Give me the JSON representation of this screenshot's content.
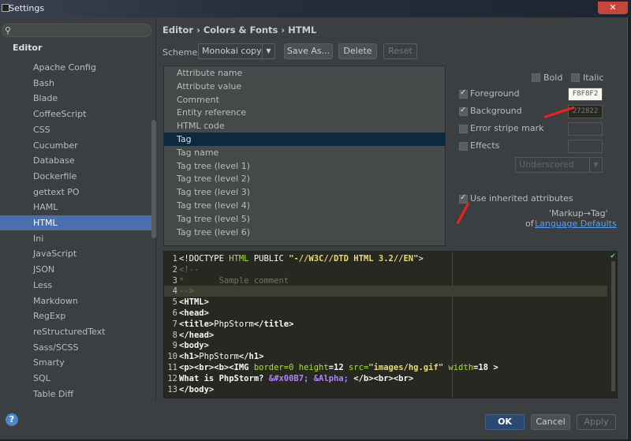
{
  "window": {
    "title": "Settings",
    "close_icon": "close-icon"
  },
  "sidebar": {
    "search_placeholder": "",
    "section": "Editor",
    "items": [
      "Apache Config",
      "Bash",
      "Blade",
      "CoffeeScript",
      "CSS",
      "Cucumber",
      "Database",
      "Dockerfile",
      "gettext PO",
      "HAML",
      "HTML",
      "Ini",
      "JavaScript",
      "JSON",
      "Less",
      "Markdown",
      "RegExp",
      "reStructuredText",
      "Sass/SCSS",
      "Smarty",
      "SQL",
      "Table Diff"
    ],
    "selected": "HTML"
  },
  "main": {
    "breadcrumb": "Editor › Colors & Fonts › HTML",
    "scheme_label": "Scheme:",
    "scheme_value": "Monokai copy",
    "save_as": "Save As...",
    "delete": "Delete",
    "reset": "Reset",
    "attributes": [
      "Attribute name",
      "Attribute value",
      "Comment",
      "Entity reference",
      "HTML code",
      "Tag",
      "Tag name",
      "Tag tree (level 1)",
      "Tag tree (level 2)",
      "Tag tree (level 3)",
      "Tag tree (level 4)",
      "Tag tree (level 5)",
      "Tag tree (level 6)"
    ],
    "selected_attribute": "Tag",
    "bold": "Bold",
    "italic": "Italic",
    "foreground": "Foreground",
    "foreground_value": "F8F8F2",
    "background": "Background",
    "background_value": "272822",
    "error_stripe": "Error stripe mark",
    "effects": "Effects",
    "effect_type": "Underscored",
    "use_inherited": "Use inherited attributes",
    "inherit_from": "'Markup→Tag'",
    "inherit_of": "of",
    "inherit_link": "Language Defaults"
  },
  "colors": {
    "foreground": "#F8F8F2",
    "background": "#272822",
    "selection": "#4b6eaf"
  },
  "code": [
    [
      [
        "<!DOCTYPE ",
        "dt"
      ],
      [
        "HTML",
        "at"
      ],
      [
        " PUBLIC ",
        "dt"
      ],
      [
        "\"-//W3C//DTD HTML 3.2//EN\"",
        "st"
      ],
      [
        ">",
        "dt"
      ]
    ],
    [
      [
        "<!--",
        "cm"
      ]
    ],
    [
      [
        "*       Sample comment",
        "cm"
      ]
    ],
    [
      [
        "-->",
        "cm"
      ]
    ],
    [
      [
        "<HTML>",
        "tg"
      ]
    ],
    [
      [
        "<head>",
        "tg"
      ]
    ],
    [
      [
        "<title>",
        "tg"
      ],
      [
        "PhpStorm",
        "tx"
      ],
      [
        "</title>",
        "tg"
      ]
    ],
    [
      [
        "</head>",
        "tg"
      ]
    ],
    [
      [
        "<body>",
        "tg"
      ]
    ],
    [
      [
        "<h1>",
        "tg"
      ],
      [
        "PhpStorm",
        "tx"
      ],
      [
        "</h1>",
        "tg"
      ]
    ],
    [
      [
        "<p><br><b><IMG ",
        "tg"
      ],
      [
        "border",
        "at"
      ],
      [
        "=0 ",
        "at"
      ],
      [
        "height",
        "at"
      ],
      [
        "=12 ",
        "tg"
      ],
      [
        "src",
        "at"
      ],
      [
        "=",
        "at"
      ],
      [
        "\"images/hg.gif\"",
        "st"
      ],
      [
        " width",
        "at"
      ],
      [
        "=18 ",
        "tg"
      ],
      [
        ">",
        "tg"
      ]
    ],
    [
      [
        "What is PhpStorm? ",
        "tg"
      ],
      [
        "&#x00B7;",
        "en"
      ],
      [
        " ",
        "tx"
      ],
      [
        "&Alpha;",
        "en"
      ],
      [
        " </b><br><br>",
        "tg"
      ]
    ],
    [
      [
        "</body>",
        "tg"
      ]
    ]
  ],
  "footer": {
    "help": "?",
    "ok": "OK",
    "cancel": "Cancel",
    "apply": "Apply"
  }
}
